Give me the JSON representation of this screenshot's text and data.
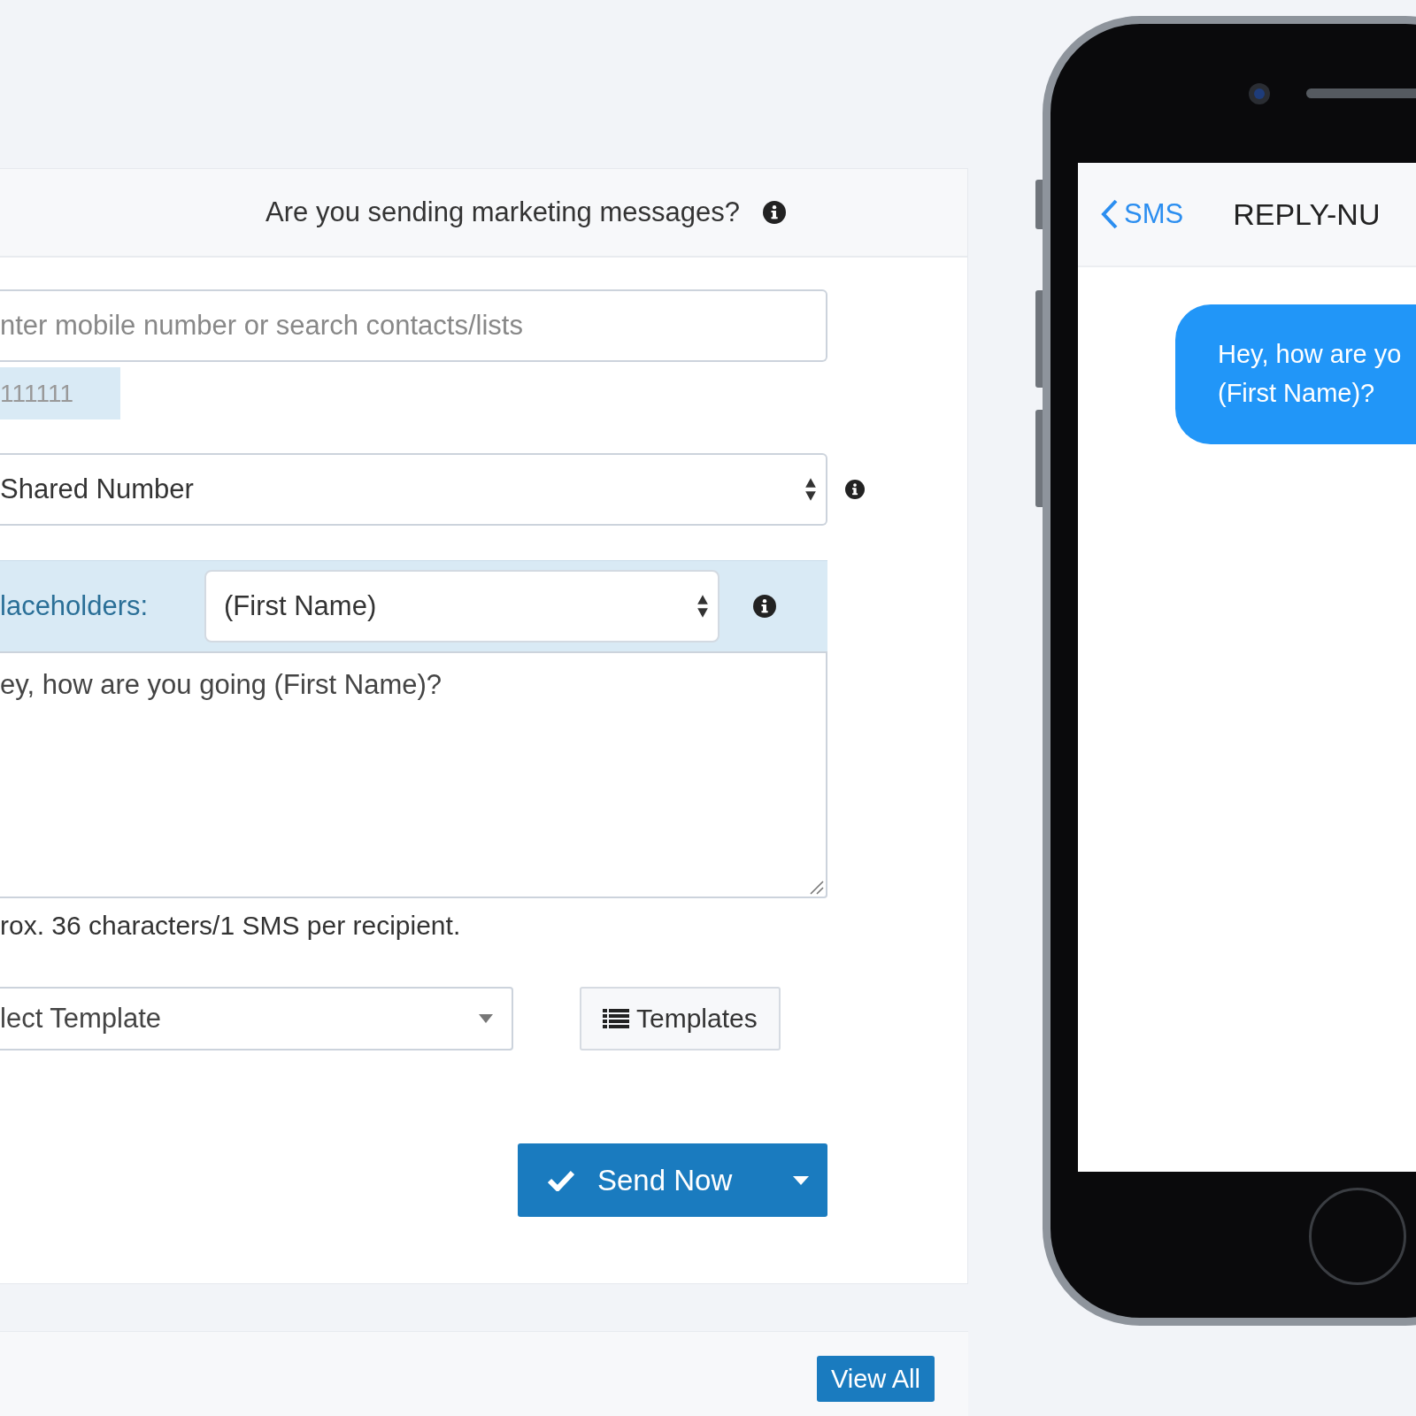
{
  "marketing_prompt": "Are you sending marketing messages?",
  "recipient_field": {
    "placeholder": "nter mobile number or search contacts/lists"
  },
  "recipient_chip": "111111",
  "sender_select": {
    "value": "Shared Number"
  },
  "placeholders": {
    "label": "laceholders:",
    "select": "(First Name)"
  },
  "message": {
    "value": "ey, how are you going (First Name)?"
  },
  "character_count": "rox. 36 characters/1 SMS per recipient.",
  "template_select": {
    "value": "lect Template"
  },
  "templates_button": "Templates",
  "send_button": "Send Now",
  "view_all_button": "View All",
  "phone": {
    "back_label": "SMS",
    "title": "REPLY-NU",
    "bubble_lines": [
      "Hey, how are yo",
      "(First Name)?"
    ]
  }
}
